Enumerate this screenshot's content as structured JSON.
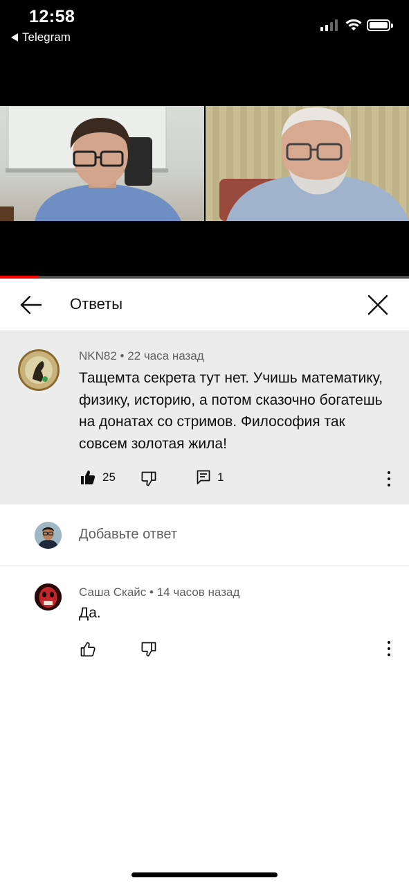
{
  "status_bar": {
    "time": "12:58",
    "back_app": "Telegram"
  },
  "video": {
    "progress": 0.095,
    "progress_color": "#ff0000"
  },
  "header": {
    "title": "Ответы"
  },
  "parent_comment": {
    "author": "NKN82",
    "time": "22 часа назад",
    "text": "Тащемта секрета тут нет. Учишь математику, физику, историю, а потом сказочно богатешь на донатах со стримов. Философия так совсем золотая жила!",
    "likes": "25",
    "replies": "1"
  },
  "add_reply": {
    "placeholder": "Добавьте ответ"
  },
  "replies": [
    {
      "author": "Саша Скайс",
      "time": "14 часов назад",
      "text": "Да."
    }
  ],
  "icons": {
    "back": "arrow-left-icon",
    "close": "close-icon",
    "like": "thumb-up-icon",
    "dislike": "thumb-down-icon",
    "reply": "comment-icon",
    "more": "more-vertical-icon"
  }
}
